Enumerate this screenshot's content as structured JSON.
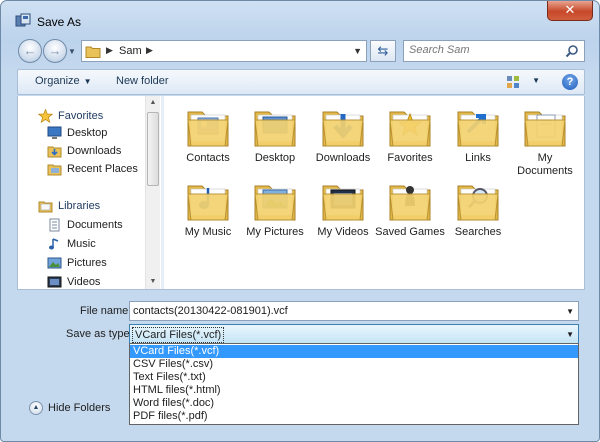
{
  "window": {
    "title": "Save As",
    "close_label": "✕"
  },
  "address": {
    "crumb": "Sam",
    "search_placeholder": "Search Sam"
  },
  "toolbar": {
    "organize": "Organize",
    "new_folder": "New folder",
    "help": "?"
  },
  "nav_pane": {
    "items": [
      {
        "label": "Favorites",
        "icon": "star-icon",
        "group": true
      },
      {
        "label": "Desktop",
        "icon": "desktop-icon",
        "group": false
      },
      {
        "label": "Downloads",
        "icon": "downloads-icon",
        "group": false
      },
      {
        "label": "Recent Places",
        "icon": "recent-places-icon",
        "group": false
      },
      {
        "label": "Libraries",
        "icon": "libraries-icon",
        "group": true
      },
      {
        "label": "Documents",
        "icon": "documents-icon",
        "group": false
      },
      {
        "label": "Music",
        "icon": "music-icon",
        "group": false
      },
      {
        "label": "Pictures",
        "icon": "pictures-icon",
        "group": false
      },
      {
        "label": "Videos",
        "icon": "videos-icon",
        "group": false
      }
    ]
  },
  "files": [
    {
      "label": "Contacts",
      "icon": "contacts-folder-icon"
    },
    {
      "label": "Desktop",
      "icon": "desktop-folder-icon"
    },
    {
      "label": "Downloads",
      "icon": "downloads-folder-icon"
    },
    {
      "label": "Favorites",
      "icon": "favorites-folder-icon"
    },
    {
      "label": "Links",
      "icon": "links-folder-icon"
    },
    {
      "label": "My Documents",
      "icon": "my-documents-folder-icon"
    },
    {
      "label": "My Music",
      "icon": "my-music-folder-icon"
    },
    {
      "label": "My Pictures",
      "icon": "my-pictures-folder-icon"
    },
    {
      "label": "My Videos",
      "icon": "my-videos-folder-icon"
    },
    {
      "label": "Saved Games",
      "icon": "saved-games-folder-icon"
    },
    {
      "label": "Searches",
      "icon": "searches-folder-icon"
    }
  ],
  "form": {
    "file_name_label": "File name:",
    "file_name_value": "contacts(20130422-081901).vcf",
    "save_type_label": "Save as type:",
    "save_type_value": "VCard Files(*.vcf)",
    "save_type_options": [
      "VCard Files(*.vcf)",
      "CSV Files(*.csv)",
      "Text Files(*.txt)",
      "HTML files(*.html)",
      "Word files(*.doc)",
      "PDF files(*.pdf)"
    ]
  },
  "hide_folders": "Hide Folders",
  "colors": {
    "selection": "#3399ff",
    "frame": "#c4d8ee",
    "folder": "#f2cf6b"
  }
}
